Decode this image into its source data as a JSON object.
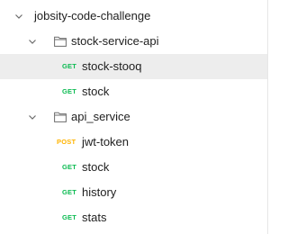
{
  "collection": {
    "name": "jobsity-code-challenge"
  },
  "folders": [
    {
      "name": "stock-service-api",
      "requests": [
        {
          "method": "GET",
          "name": "stock-stooq",
          "selected": true
        },
        {
          "method": "GET",
          "name": "stock",
          "selected": false
        }
      ]
    },
    {
      "name": "api_service",
      "requests": [
        {
          "method": "POST",
          "name": "jwt-token",
          "selected": false
        },
        {
          "method": "GET",
          "name": "stock",
          "selected": false
        },
        {
          "method": "GET",
          "name": "history",
          "selected": false
        },
        {
          "method": "GET",
          "name": "stats",
          "selected": false
        }
      ]
    }
  ],
  "colors": {
    "get": "#0cbb52",
    "post": "#ffb400",
    "selected_bg": "#ededed"
  }
}
